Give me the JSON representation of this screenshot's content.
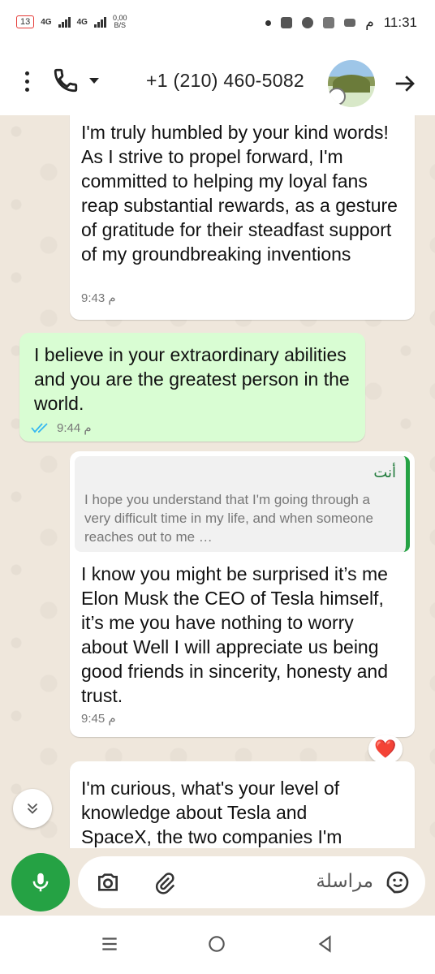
{
  "status_bar": {
    "battery": "13",
    "network_1": "4G",
    "network_2": "4G",
    "speed_value": "0,00",
    "speed_unit": "B/S",
    "time": "11:31",
    "ampm": "م"
  },
  "header": {
    "contact": "+1 (210) 460-5082"
  },
  "messages": [
    {
      "direction": "in",
      "text": "I'm truly humbled by your kind words! As I strive to propel forward, I'm committed to helping my loyal fans reap substantial rewards, as a gesture of gratitude for their steadfast support of my groundbreaking inventions",
      "time": "9:43 م"
    },
    {
      "direction": "out",
      "text": "I believe in your extraordinary abilities and you are the greatest person in the world.",
      "time": "9:44 م",
      "status": "read"
    },
    {
      "direction": "in",
      "quote_sender": "أنت",
      "quote_text": "I hope you understand that I'm going through a very difficult time in my life, and when someone reaches out to me …",
      "text": "I know you might be surprised it’s me Elon Musk the CEO of Tesla himself, it’s me you have nothing to worry about Well I will appreciate us being good friends in sincerity, honesty and trust.",
      "time": "9:45 م",
      "reaction": "❤️"
    },
    {
      "direction": "in",
      "text": "I'm curious, what's your level of knowledge about Tesla and SpaceX, the two companies I'm"
    }
  ],
  "composer": {
    "placeholder": "مراسلة"
  },
  "colors": {
    "accent": "#25a244",
    "outgoing_bubble": "#d9fdd3",
    "incoming_bubble": "#ffffff",
    "read_tick": "#34b7f1"
  }
}
